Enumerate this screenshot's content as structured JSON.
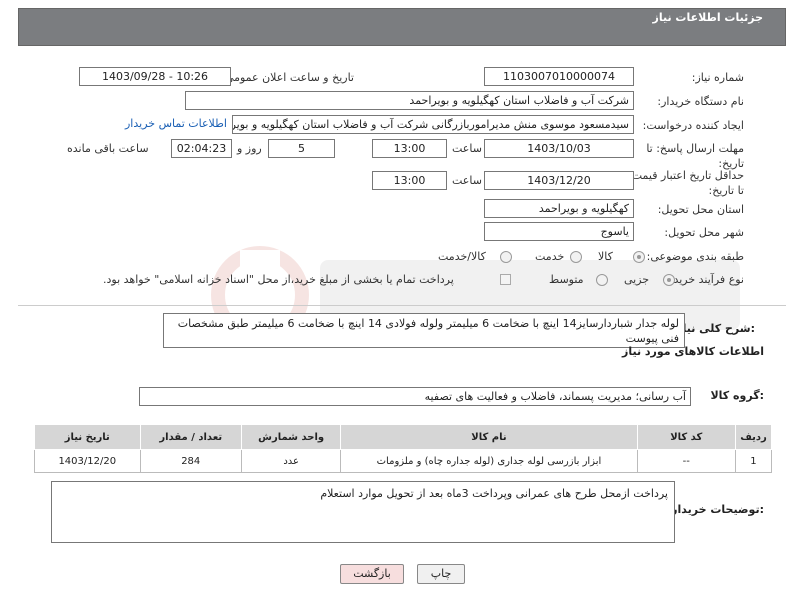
{
  "header": {
    "title": "جزئیات اطلاعات نیاز"
  },
  "fields": {
    "need_number": {
      "label": "شماره نیاز:",
      "value": "1103007010000074"
    },
    "announce_datetime": {
      "label": "تاریخ و ساعت اعلان عمومی:",
      "value": "1403/09/28 - 10:26"
    },
    "buyer_org": {
      "label": "نام دستگاه خریدار:",
      "value": "شرکت آب و فاضلاب استان کهگیلویه و بویراحمد"
    },
    "requester": {
      "label": "ایجاد کننده درخواست:",
      "value": "سیدمسعود موسوی منش مدیراموربازرگانی شرکت آب و فاضلاب استان کهگیلویه و بویراحمد",
      "contact_link": "اطلاعات تماس خریدار"
    },
    "reply_deadline": {
      "label": "مهلت ارسال پاسخ: تا تاریخ:",
      "date": "1403/10/03",
      "time_label": "ساعت",
      "time": "13:00",
      "days": "5",
      "days_label": "روز و",
      "remaining": "02:04:23",
      "remaining_label": "ساعت باقی مانده"
    },
    "price_validity": {
      "label": "حداقل تاریخ اعتبار قیمت: تا تاریخ:",
      "date": "1403/12/20",
      "time_label": "ساعت",
      "time": "13:00"
    },
    "delivery_province": {
      "label": "استان محل تحویل:",
      "value": "کهگیلویه و بویراحمد"
    },
    "delivery_city": {
      "label": "شهر محل تحویل:",
      "value": "یاسوج"
    },
    "category": {
      "label": "طبقه بندی موضوعی:",
      "options": [
        "کالا",
        "خدمت",
        "کالا/خدمت"
      ],
      "selected": "کالا"
    },
    "process_type": {
      "label": "نوع فرآیند خرید :",
      "options": [
        "جزیی",
        "متوسط"
      ],
      "selected": "جزیی",
      "treasury_note": "پرداخت تمام یا بخشی از مبلغ خرید،از محل \"اسناد خزانه اسلامی\" خواهد بود."
    }
  },
  "description": {
    "label": "شرح کلی نیاز:",
    "value": "لوله جدار شباردارسایز14 اینچ با ضخامت 6 میلیمتر ولوله فولادی 14 اینچ با ضخامت 6 میلیمتر طبق مشخصات فنی پیوست"
  },
  "goods_info_title": "اطلاعات کالاهای مورد نیاز",
  "goods_group": {
    "label": "گروه کالا:",
    "value": "آب رسانی؛ مدیریت پسماند، فاضلاب و فعالیت های تصفیه"
  },
  "table": {
    "headers": [
      "ردیف",
      "کد کالا",
      "نام کالا",
      "واحد شمارش",
      "تعداد / مقدار",
      "تاریخ نیاز"
    ],
    "rows": [
      [
        "1",
        "--",
        "ابزار بازرسی لوله جداری (لوله جداره چاه) و ملزومات",
        "عدد",
        "284",
        "1403/12/20"
      ]
    ]
  },
  "buyer_notes": {
    "label": "توضیحات خریدار:",
    "value": "پرداخت ازمحل طرح های عمرانی وپرداخت 3ماه  بعد از تحویل  موارد استعلام"
  },
  "buttons": {
    "print": "چاپ",
    "back": "بازگشت"
  },
  "colors": {
    "header_bg": "#7b7d80",
    "link": "#1a5fb4",
    "back_button_bg": "#f7dede"
  }
}
